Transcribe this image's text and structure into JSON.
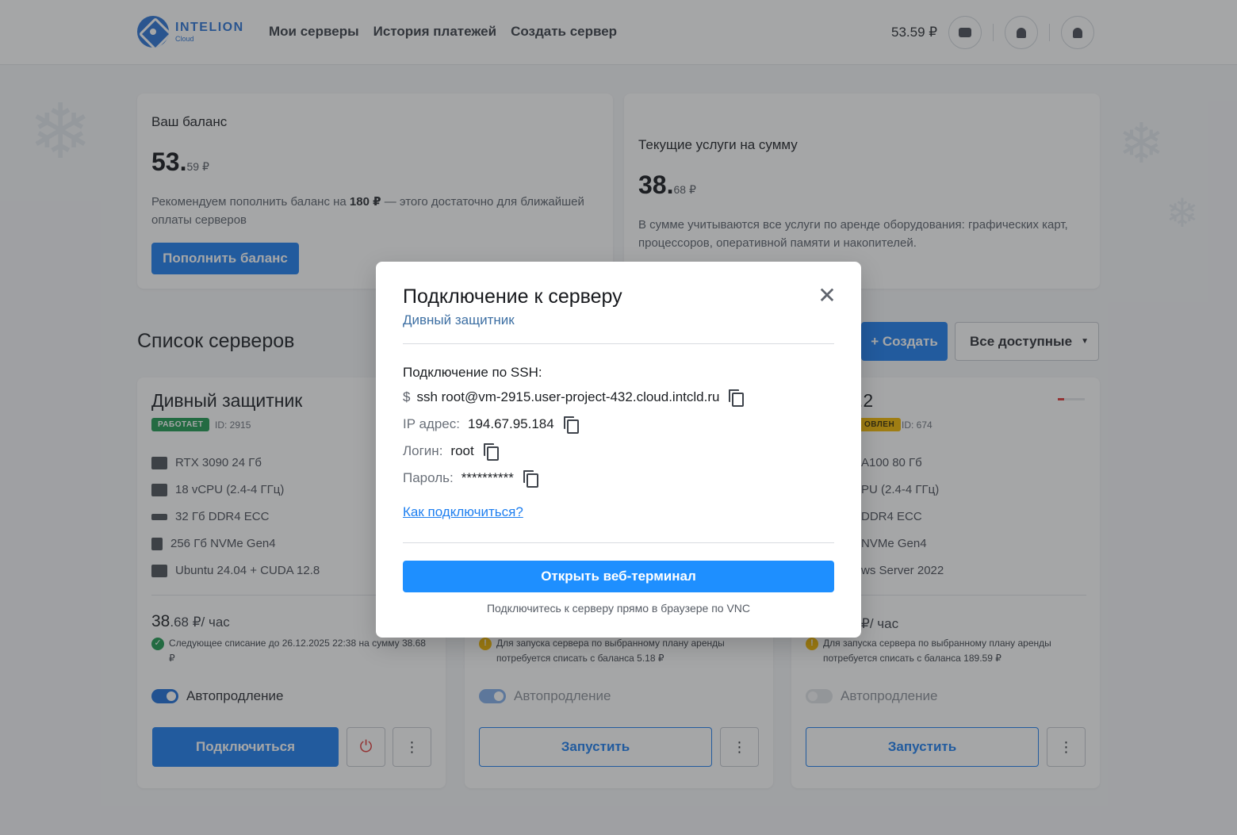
{
  "header": {
    "logo_name": "INTELION",
    "logo_sub": "Cloud",
    "nav": [
      "Мои серверы",
      "История платежей",
      "Создать сервер"
    ],
    "balance": "53.59 ₽",
    "wallet_icon": "wallet-icon",
    "bell_icon": "bell-icon",
    "user_icon": "user-icon"
  },
  "balance_card": {
    "label": "Ваш баланс",
    "amount_int": "53.",
    "amount_frac": "59 ₽",
    "rec_before": "Рекомендуем пополнить баланс на ",
    "rec_amount": "180 ₽",
    "rec_after": " — этого достаточно для ближайшей оплаты серверов",
    "topup_button": "Пополнить баланс"
  },
  "services_card": {
    "label": "Текущие услуги на сумму",
    "amount_int": "38.",
    "amount_frac": "68 ₽",
    "description": "В сумме учитываются все услуги по аренде оборудования: графических карт, процессоров, оперативной памяти и накопителей."
  },
  "servers_section": {
    "title": "Список серверов",
    "create_button": "+ Создать",
    "filter_select": "Все доступные"
  },
  "servers": [
    {
      "name": "Дивный защитник",
      "status": "РАБОТАЕТ",
      "status_color": "#1f9a52",
      "id": "ID: 2915",
      "specs": [
        "RTX 3090 24 Гб",
        "18 vCPU (2.4-4 ГГц)",
        "32 Гб DDR4 ECC",
        "256 Гб NVMe Gen4",
        "Ubuntu 24.04 + CUDA 12.8"
      ],
      "price_int": "38",
      "price_frac": ".68 ₽/ час",
      "note": "Следующее списание до 26.12.2025 22:38 на сумму 38.68 ₽",
      "autorenew": "Автопродление",
      "action": "Подключиться"
    },
    {
      "note": "Для запуска сервера по выбранному плану аренды потребуется списать с баланса 5.18 ₽",
      "autorenew": "Автопродление",
      "action": "Запустить"
    },
    {
      "name_tail": ".2",
      "status": "ОВЛЕН",
      "status_color": "#f5b800",
      "id": "ID: 674",
      "specs": [
        "A100 80 Гб",
        "PU (2.4-4 ГГц)",
        "DDR4 ECC",
        "NVMe Gen4",
        "ws Server 2022"
      ],
      "price": "₽/ час",
      "note": "Для запуска сервера по выбранному плану аренды потребуется списать с баланса 189.59 ₽",
      "autorenew": "Автопродление",
      "action": "Запустить"
    }
  ],
  "modal": {
    "title": "Подключение к серверу",
    "subtitle": "Дивный защитник",
    "ssh_label": "Подключение по SSH:",
    "ssh_prompt": "$",
    "ssh_command": "ssh root@vm-2915.user-project-432.cloud.intcld.ru",
    "ip_label": "IP адрес:",
    "ip_value": "194.67.95.184",
    "login_label": "Логин:",
    "login_value": "root",
    "password_label": "Пароль:",
    "password_value": "**********",
    "how_link": "Как подключиться?",
    "web_terminal_button": "Открыть веб-терминал",
    "web_terminal_hint": "Подключитесь к серверу прямо в браузере по VNC",
    "close_icon": "close-icon",
    "copy_icon": "copy-icon"
  }
}
